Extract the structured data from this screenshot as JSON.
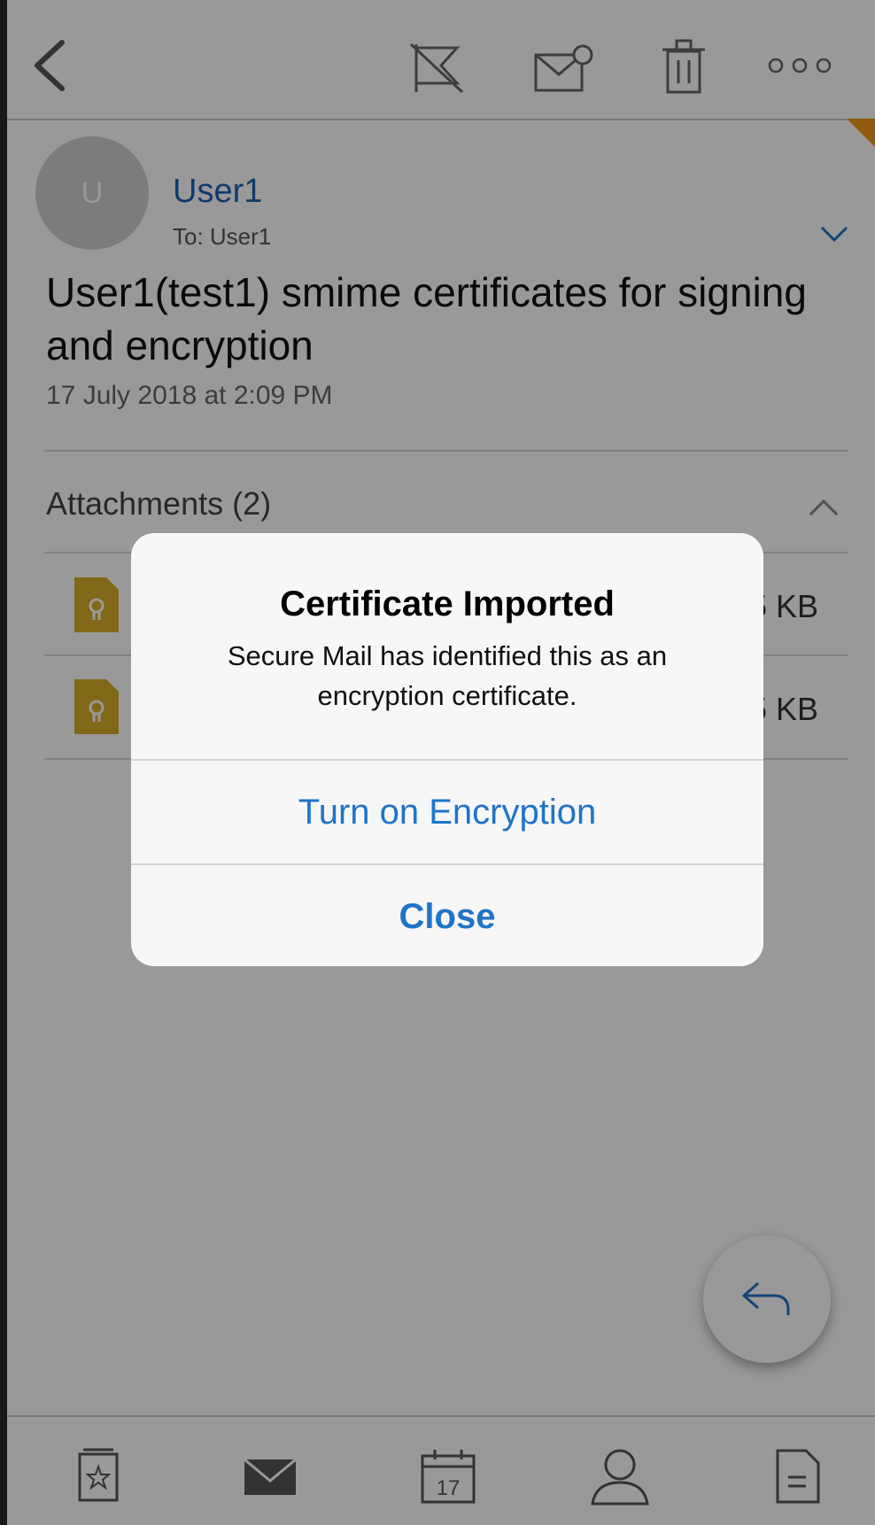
{
  "sender": {
    "avatar_initial": "U",
    "name": "User1",
    "to": "To: User1"
  },
  "message": {
    "subject": "User1(test1) smime certificates for signing and encryption",
    "date": "17 July 2018 at 2:09 PM"
  },
  "attachments": {
    "header": "Attachments (2)",
    "items": [
      {
        "size_visible": "5 KB"
      },
      {
        "size_visible": "5 KB"
      }
    ]
  },
  "tabbar": {
    "calendar_day": "17"
  },
  "alert": {
    "title": "Certificate Imported",
    "message": "Secure Mail has identified this as an encryption certificate.",
    "primary_button": "Turn on Encryption",
    "close_button": "Close"
  },
  "colors": {
    "link_blue": "#1f74c8",
    "sender_blue": "#1a63b5",
    "attachment_gold": "#d8ad2b",
    "corner_orange": "#f29a17"
  },
  "icons": [
    "back-icon",
    "flag-icon",
    "mark-unread-icon",
    "trash-icon",
    "more-icon",
    "chevron-down-icon",
    "chevron-up-icon",
    "certificate-file-icon",
    "reply-icon",
    "favorites-icon",
    "mail-icon",
    "calendar-icon",
    "contacts-icon",
    "notes-icon"
  ]
}
